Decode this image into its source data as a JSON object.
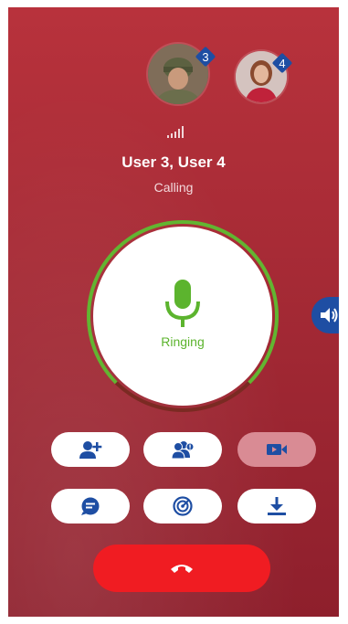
{
  "participants": [
    {
      "name": "User 3",
      "badge": "3",
      "avatar_icon": "soldier-avatar"
    },
    {
      "name": "User 4",
      "badge": "4",
      "avatar_icon": "woman-avatar"
    }
  ],
  "call": {
    "title": "User 3, User 4",
    "status": "Calling",
    "state_label": "Ringing",
    "signal_icon": "signal-bars-icon"
  },
  "actions": [
    {
      "name": "add-participant",
      "icon": "add-user-icon",
      "enabled": true
    },
    {
      "name": "participants-info",
      "icon": "group-info-icon",
      "enabled": true
    },
    {
      "name": "video",
      "icon": "video-camera-icon",
      "enabled": false
    },
    {
      "name": "chat",
      "icon": "chat-bubble-icon",
      "enabled": true
    },
    {
      "name": "radar",
      "icon": "radar-icon",
      "enabled": true
    },
    {
      "name": "download",
      "icon": "download-icon",
      "enabled": true
    }
  ],
  "colors": {
    "background": "#a52a35",
    "accent_blue": "#1e4ea3",
    "ringing_green": "#5cb42e",
    "end_call_red": "#f01c22",
    "disabled_button": "#d98b94"
  }
}
